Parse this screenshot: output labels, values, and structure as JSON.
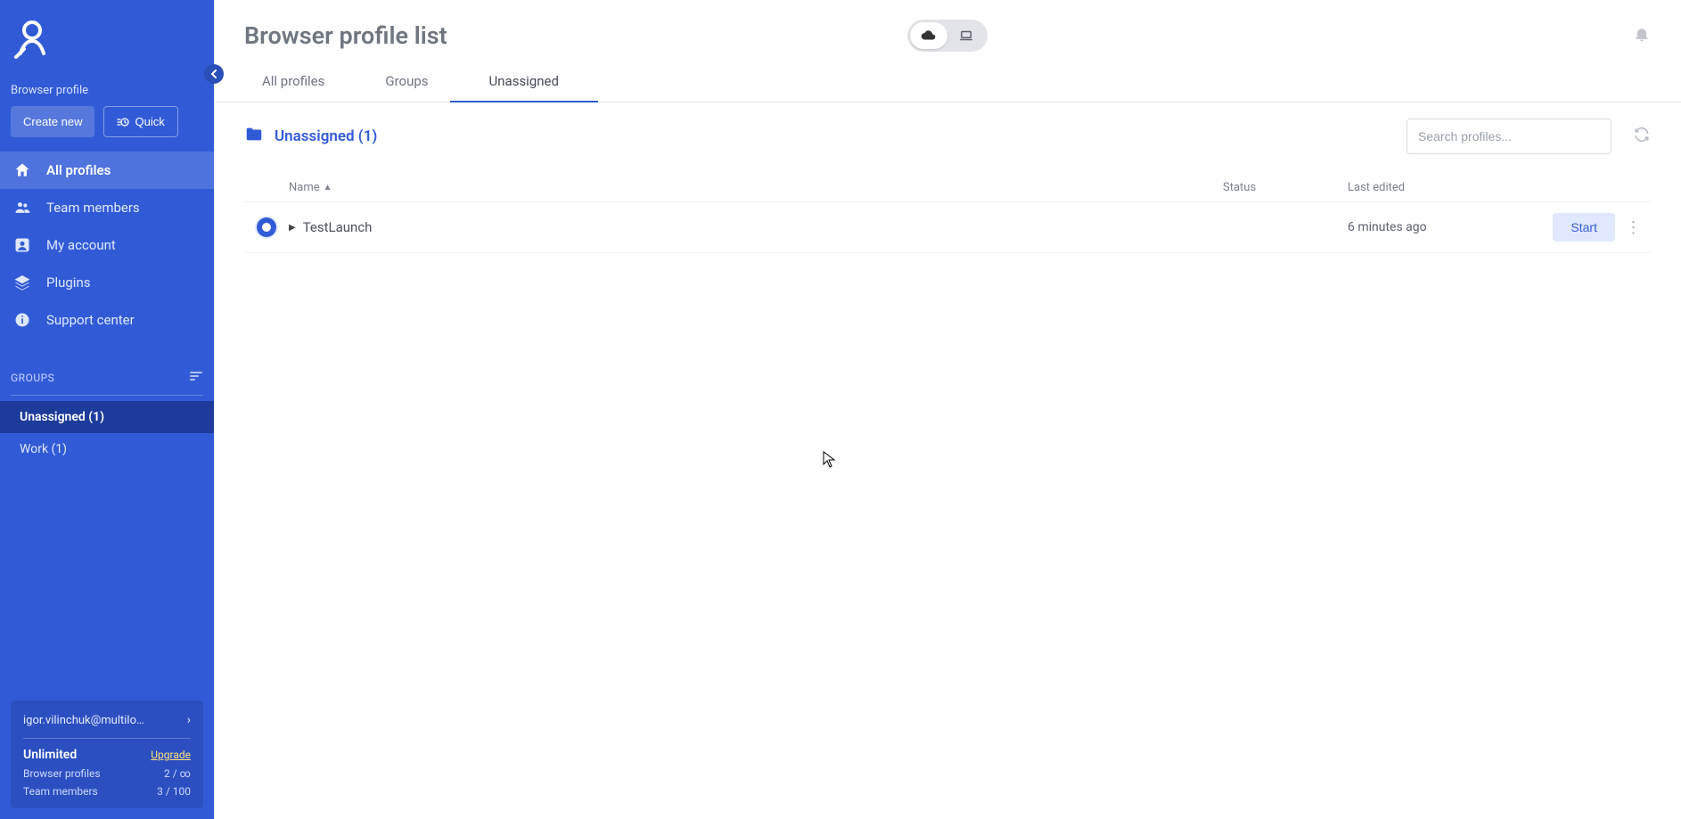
{
  "sidebar": {
    "section_label": "Browser profile",
    "create_btn": "Create new",
    "quick_btn": "Quick",
    "nav": {
      "all_profiles": "All profiles",
      "team_members": "Team members",
      "my_account": "My account",
      "plugins": "Plugins",
      "support_center": "Support center"
    },
    "groups_heading": "GROUPS",
    "groups": [
      {
        "label": "Unassigned  (1)",
        "active": true
      },
      {
        "label": "Work  (1)",
        "active": false
      }
    ]
  },
  "account": {
    "email": "igor.vilinchuk@multilo…",
    "plan_name": "Unlimited",
    "upgrade_label": "Upgrade",
    "stats": {
      "profiles_label": "Browser profiles",
      "profiles_value": "2 / ∞",
      "members_label": "Team members",
      "members_value": "3 / 100"
    }
  },
  "header": {
    "title": "Browser profile list",
    "toggle": {
      "cloud": "cloud-icon",
      "local": "laptop-icon"
    }
  },
  "tabs": {
    "all_profiles": "All profiles",
    "groups": "Groups",
    "unassigned": "Unassigned"
  },
  "folder": {
    "label": "Unassigned (1)"
  },
  "search": {
    "placeholder": "Search profiles..."
  },
  "table": {
    "columns": {
      "name": "Name",
      "status": "Status",
      "last_edited": "Last edited"
    },
    "rows": [
      {
        "name": "TestLaunch",
        "status": "",
        "last_edited": "6 minutes ago",
        "action": "Start"
      }
    ]
  }
}
